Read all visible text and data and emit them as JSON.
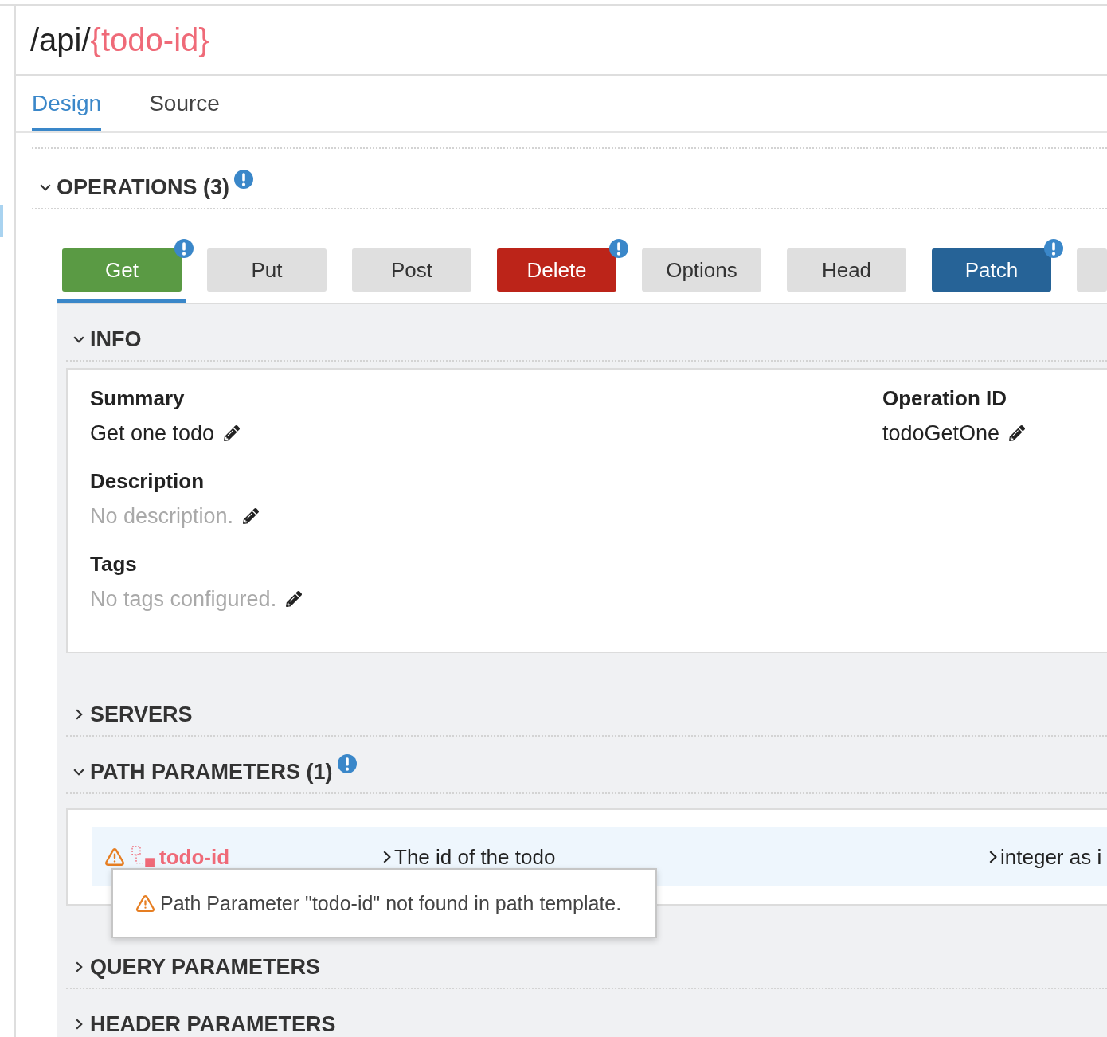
{
  "sidebar": {
    "items": [
      {
        "selected": true
      }
    ]
  },
  "path_title": {
    "base": "/api/",
    "parameter": "{todo-id}"
  },
  "tabs": [
    {
      "label": "Design",
      "selected": true
    },
    {
      "label": "Source",
      "selected": false
    }
  ],
  "operations": {
    "title": "OPERATIONS (3)",
    "expanded": true,
    "warning": true,
    "methods": [
      {
        "label": "Get",
        "defined": true,
        "color": "#5a9a44",
        "warning": true,
        "selected": true
      },
      {
        "label": "Put",
        "defined": false,
        "warning": false,
        "selected": false
      },
      {
        "label": "Post",
        "defined": false,
        "warning": false,
        "selected": false
      },
      {
        "label": "Delete",
        "defined": true,
        "color": "#bc2419",
        "warning": true,
        "selected": false
      },
      {
        "label": "Options",
        "defined": false,
        "warning": false,
        "selected": false
      },
      {
        "label": "Head",
        "defined": false,
        "warning": false,
        "selected": false
      },
      {
        "label": "Patch",
        "defined": true,
        "color": "#266397",
        "warning": true,
        "selected": false
      },
      {
        "defined": false,
        "warning": false,
        "selected": false
      }
    ]
  },
  "sections": [
    {
      "kind": "info",
      "title": "INFO",
      "expanded": true,
      "warning": false,
      "columns": [
        [
          {
            "label": "Summary",
            "value": "Get one todo",
            "empty": false
          },
          {
            "label": "Description",
            "value": "No description.",
            "empty": true
          },
          {
            "label": "Tags",
            "value": "No tags configured.",
            "empty": true
          }
        ],
        [
          {
            "label": "Operation ID",
            "value": "todoGetOne",
            "empty": false
          }
        ]
      ]
    },
    {
      "kind": "servers",
      "title": "SERVERS",
      "expanded": false,
      "warning": false
    },
    {
      "kind": "parameters",
      "title": "PATH PARAMETERS (1)",
      "expanded": true,
      "warning": true,
      "rows": [
        {
          "name": "todo-id",
          "description": "The id of the todo",
          "type": "integer as i",
          "warning": true,
          "tooltip": "Path Parameter \"todo-id\" not found in path template."
        }
      ]
    },
    {
      "kind": "parameters",
      "title": "QUERY PARAMETERS",
      "expanded": false,
      "warning": false
    },
    {
      "kind": "parameters",
      "title": "HEADER PARAMETERS",
      "expanded": false,
      "warning": false
    }
  ]
}
